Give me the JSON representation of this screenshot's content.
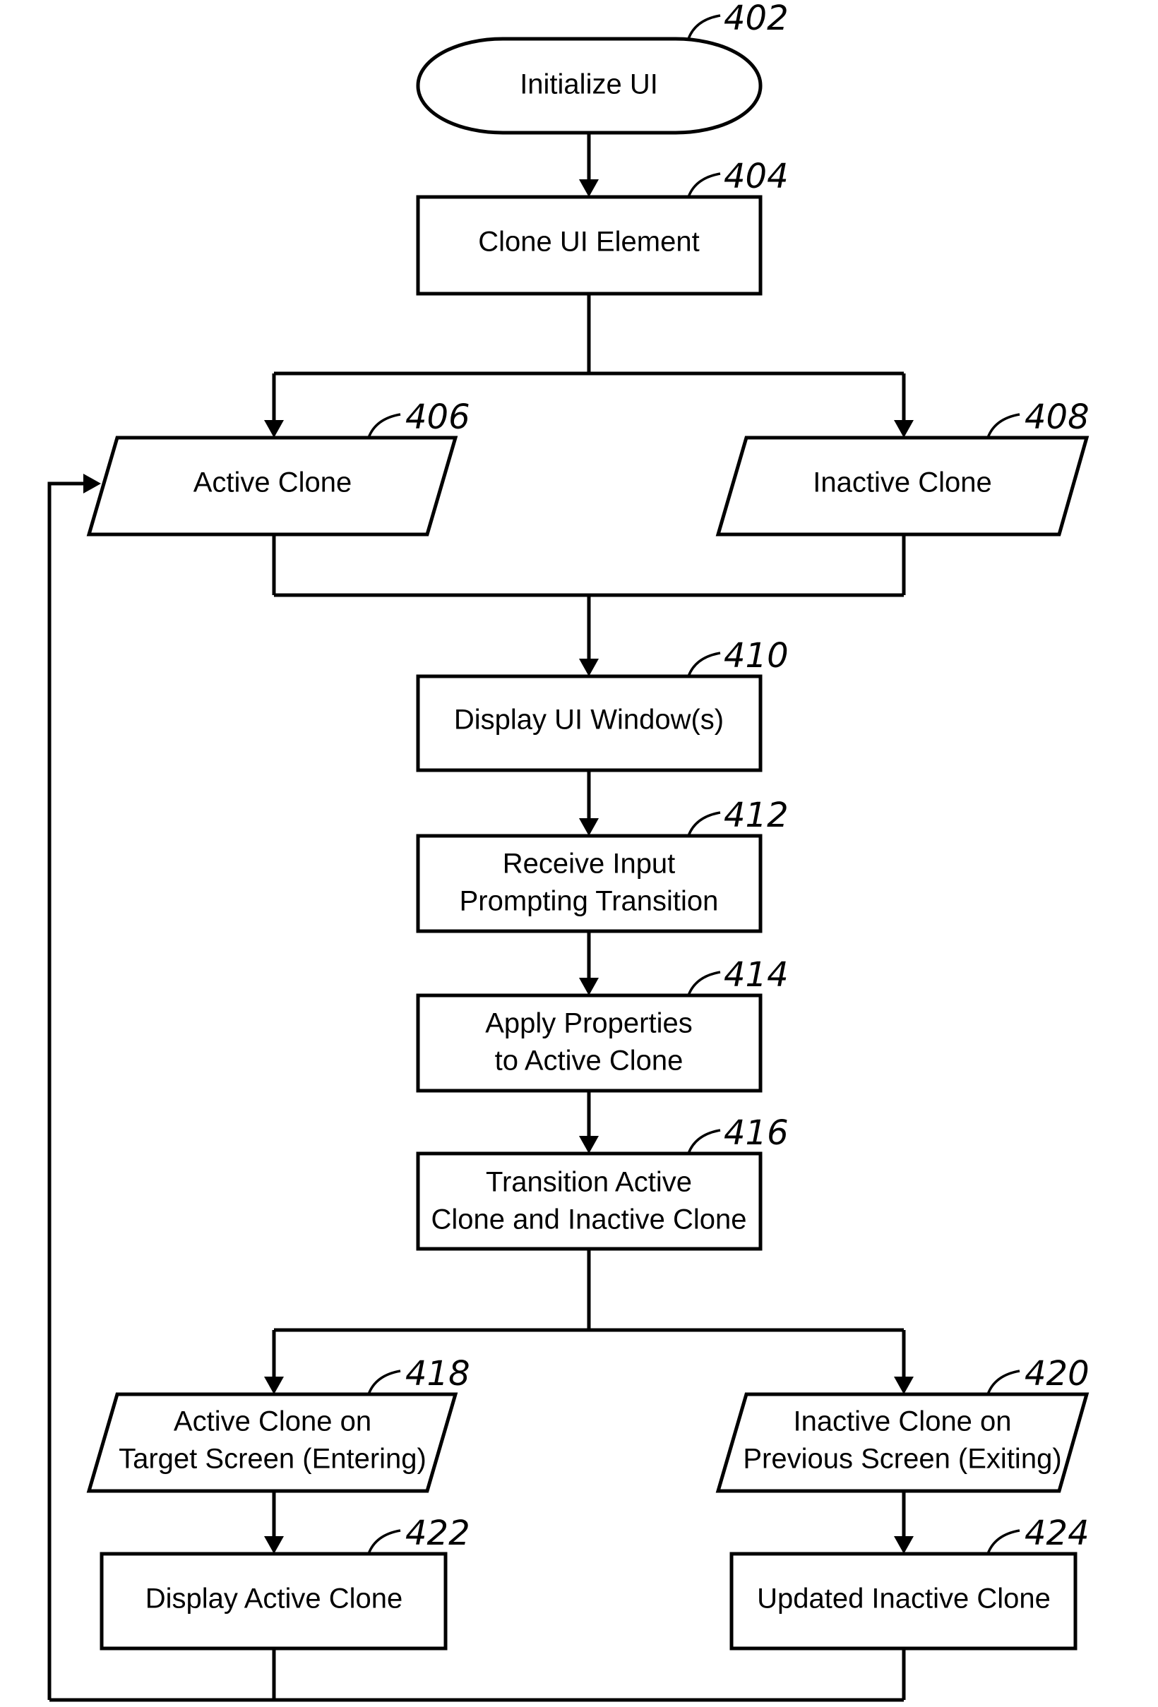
{
  "figure": {
    "type": "flowchart",
    "nodes": [
      {
        "id": "402",
        "shape": "terminator",
        "lines": [
          "Initialize UI"
        ]
      },
      {
        "id": "404",
        "shape": "process",
        "lines": [
          "Clone UI Element"
        ]
      },
      {
        "id": "406",
        "shape": "data",
        "lines": [
          "Active Clone"
        ]
      },
      {
        "id": "408",
        "shape": "data",
        "lines": [
          "Inactive Clone"
        ]
      },
      {
        "id": "410",
        "shape": "process",
        "lines": [
          "Display UI Window(s)"
        ]
      },
      {
        "id": "412",
        "shape": "process",
        "lines": [
          "Receive Input",
          "Prompting Transition"
        ]
      },
      {
        "id": "414",
        "shape": "process",
        "lines": [
          "Apply Properties",
          "to Active Clone"
        ]
      },
      {
        "id": "416",
        "shape": "process",
        "lines": [
          "Transition Active",
          "Clone and Inactive Clone"
        ]
      },
      {
        "id": "418",
        "shape": "data",
        "lines": [
          "Active Clone on",
          "Target Screen (Entering)"
        ]
      },
      {
        "id": "420",
        "shape": "data",
        "lines": [
          "Inactive Clone on",
          "Previous Screen (Exiting)"
        ]
      },
      {
        "id": "422",
        "shape": "process",
        "lines": [
          "Display Active Clone"
        ]
      },
      {
        "id": "424",
        "shape": "process",
        "lines": [
          "Updated Inactive Clone"
        ]
      }
    ],
    "edges": [
      [
        "402",
        "404"
      ],
      [
        "404",
        "406"
      ],
      [
        "404",
        "408"
      ],
      [
        "406",
        "410"
      ],
      [
        "408",
        "410"
      ],
      [
        "410",
        "412"
      ],
      [
        "412",
        "414"
      ],
      [
        "414",
        "416"
      ],
      [
        "416",
        "418"
      ],
      [
        "416",
        "420"
      ],
      [
        "418",
        "422"
      ],
      [
        "420",
        "424"
      ],
      [
        "422",
        "406"
      ],
      [
        "424",
        "406"
      ]
    ]
  }
}
